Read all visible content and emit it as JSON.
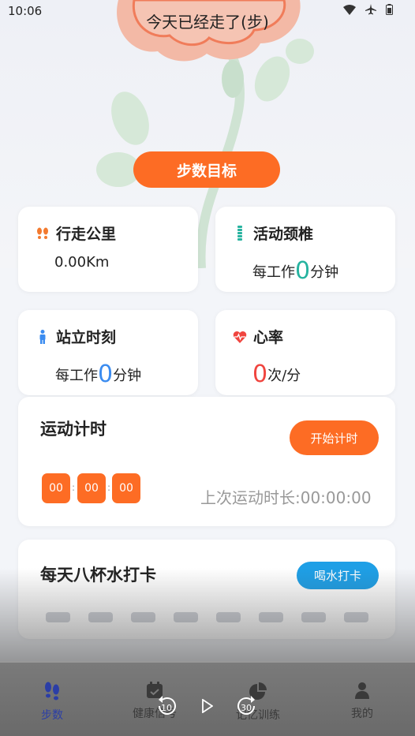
{
  "status_bar": {
    "time": "10:06"
  },
  "header": {
    "title": "今天已经走了(步)"
  },
  "goal_button": {
    "label": "步数目标"
  },
  "cards": {
    "distance": {
      "title": "行走公里",
      "value": "0.00Km"
    },
    "neck": {
      "title": "活动颈椎",
      "prefix": "每工作",
      "number": "0",
      "suffix": "分钟"
    },
    "stand": {
      "title": "站立时刻",
      "prefix": "每工作",
      "number": "0",
      "suffix": "分钟"
    },
    "heart": {
      "title": "心率",
      "number": "0",
      "unit": "次/分"
    }
  },
  "timer": {
    "title": "运动计时",
    "start_label": "开始计时",
    "hours": "00",
    "minutes": "00",
    "seconds": "00",
    "separator": ":",
    "last_label": "上次运动时长:00:00:00"
  },
  "water": {
    "title": "每天八杯水打卡",
    "button_label": "喝水打卡",
    "cups_filled": 0,
    "cups_total": 8
  },
  "media_controls": {
    "rewind_seconds": "10",
    "forward_seconds": "30"
  },
  "tabbar": {
    "items": [
      {
        "label": "步数",
        "icon": "footprints-icon",
        "active": true
      },
      {
        "label": "健康信号",
        "icon": "calendar-icon",
        "active": false
      },
      {
        "label": "记忆训练",
        "icon": "pie-chart-icon",
        "active": false
      },
      {
        "label": "我的",
        "icon": "person-icon",
        "active": false
      }
    ]
  },
  "colors": {
    "accent": "#fd6c24",
    "teal": "#27b3a0",
    "blue": "#3b8cf0",
    "red": "#f0453f",
    "water": "#1e9fe6",
    "tab_active": "#2b3ea6"
  }
}
